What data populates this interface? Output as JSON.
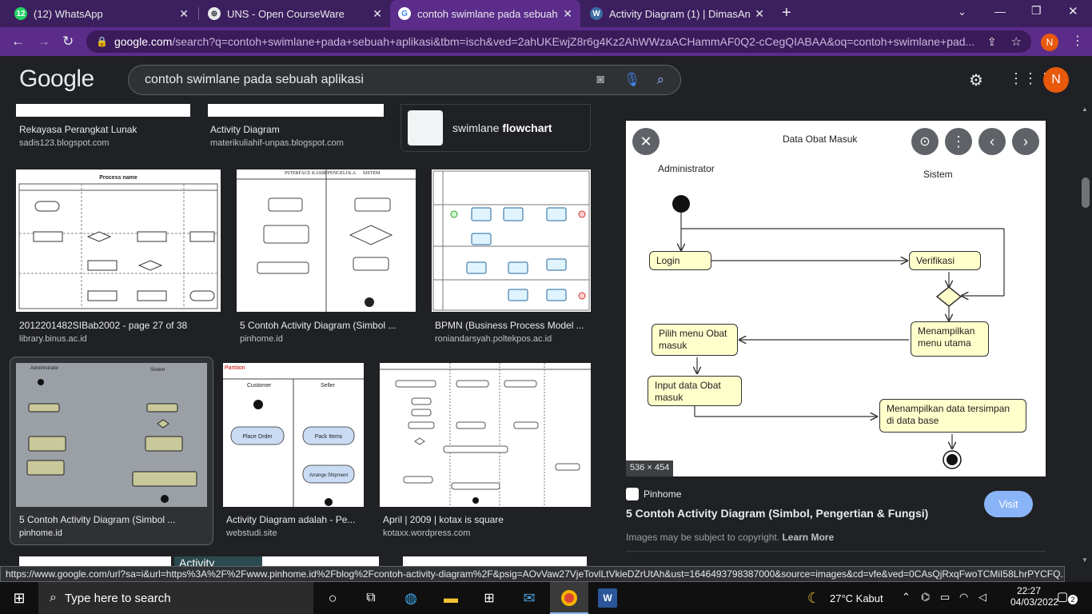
{
  "tabs": [
    {
      "title": "(12) WhatsApp",
      "fav": "12",
      "favColor": "#25d366"
    },
    {
      "title": "UNS - Open CourseWare",
      "fav": "⊕",
      "favColor": "#3c4043"
    },
    {
      "title": "contoh swimlane pada sebuah ap",
      "fav": "G",
      "favColor": "#ffffff"
    },
    {
      "title": "Activity Diagram (1) | DimasAnd",
      "fav": "W",
      "favColor": "#3b6ea5"
    }
  ],
  "address": {
    "host": "google.com",
    "rest": "/search?q=contoh+swimlane+pada+sebuah+aplikasi&tbm=isch&ved=2ahUKEwjZ8r6g4Kz2AhWWzaACHammAF0Q2-cCegQIABAA&oq=contoh+swimlane+pad..."
  },
  "google": {
    "logo": "Google",
    "query": "contoh swimlane pada sebuah aplikasi",
    "avatar": "N"
  },
  "top_results": [
    {
      "caption": "Rekayasa Perangkat Lunak",
      "source": "sadis123.blogspot.com"
    },
    {
      "caption": "Activity Diagram",
      "source": "materikuliahif-unpas.blogspot.com"
    }
  ],
  "related": {
    "plain": "swimlane ",
    "bold": "flowchart"
  },
  "row2": [
    {
      "caption": "2012201482SIBab2002 - page 27 of 38",
      "source": "library.binus.ac.id",
      "title": "Process name"
    },
    {
      "caption": "5 Contoh Activity Diagram (Simbol ...",
      "source": "pinhome.id"
    },
    {
      "caption": "BPMN (Business Process Model ...",
      "source": "roniandarsyah.poltekpos.ac.id"
    }
  ],
  "row3": [
    {
      "caption": "5 Contoh Activity Diagram (Simbol ...",
      "source": "pinhome.id"
    },
    {
      "caption": "Activity Diagram adalah - Pe...",
      "source": "webstudi.site"
    },
    {
      "caption": "April | 2009 | kotax is square",
      "source": "kotaxx.wordpress.com"
    }
  ],
  "thumb_texts": {
    "r2b_left": "INTERFACE KASIR/PENGELOLA",
    "r2b_right": "SISTEM",
    "r3a_left": "Administrator",
    "r3a_right": "Sistem",
    "r3b_partition": "Partition",
    "r3b_customer": "Customer",
    "r3b_seller": "Seller",
    "r3b_a1": "Place Order",
    "r3b_a2": "Pack Items",
    "r3b_a3": "Arrange Shipment",
    "r4_activity": "Activity"
  },
  "preview": {
    "title": "Data Obat Masuk",
    "lane_left": "Administrator",
    "lane_right": "Sistem",
    "nodes": {
      "login": "Login",
      "verifikasi": "Verifikasi",
      "pilih": "Pilih menu Obat masuk",
      "menampilkan": "Menampilkan menu utama",
      "input": "Input data Obat masuk",
      "tersimpan": "Menampilkan data tersimpan di data base"
    },
    "size": "536 × 454",
    "site": "Pinhome",
    "heading": "5 Contoh Activity Diagram (Simbol, Pengertian & Fungsi)",
    "visit": "Visit",
    "copyright": "Images may be subject to copyright.",
    "learn_more": "Learn More"
  },
  "status_url": "https://www.google.com/url?sa=i&url=https%3A%2F%2Fwww.pinhome.id%2Fblog%2Fcontoh-activity-diagram%2F&psig=AOvVaw27VjeTovlLtVkieDZrUtAh&ust=1646493798387000&source=images&cd=vfe&ved=0CAsQjRxqFwoTCMiI58LhrPYCFQ...",
  "taskbar": {
    "search_placeholder": "Type here to search",
    "weather": "27°C  Kabut",
    "time": "22:27",
    "date": "04/03/2022",
    "notif": "2"
  }
}
